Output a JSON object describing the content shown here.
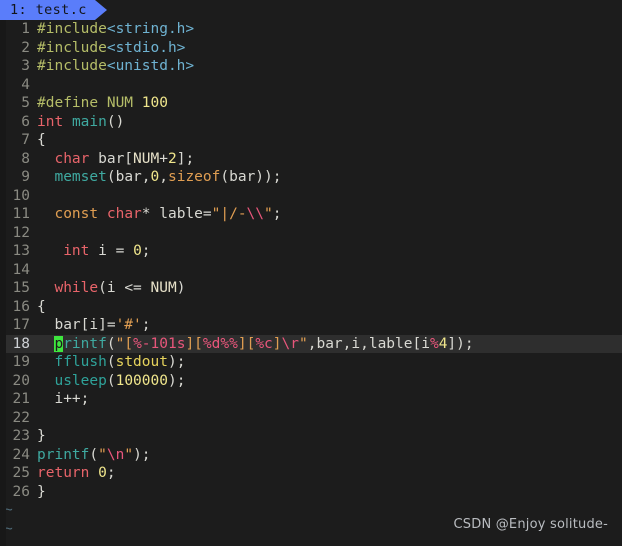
{
  "app": {
    "type": "terminal-text-editor",
    "background_color": "#1c1c1c",
    "default_text_color": "#d8d8d2"
  },
  "tabline": {
    "active_tab_label": "1: test.c",
    "tab_background_color": "#5a7dfa",
    "tab_text_color": "#13151b"
  },
  "gutter": {
    "line_number_color": "#8a8a82",
    "current_line_number_color": "#cfd2d6"
  },
  "cursor": {
    "line_number": 18,
    "column_char": "p",
    "block_color": "#3ee63e",
    "current_line_highlight_color": "#2e2e2e"
  },
  "code": {
    "language": "c",
    "filename": "test.c",
    "total_lines": 26,
    "lines": [
      {
        "n": "1",
        "text": "#include<string.h>"
      },
      {
        "n": "2",
        "text": "#include<stdio.h>"
      },
      {
        "n": "3",
        "text": "#include<unistd.h>"
      },
      {
        "n": "4",
        "text": ""
      },
      {
        "n": "5",
        "text": "#define NUM 100"
      },
      {
        "n": "6",
        "text": "int main()"
      },
      {
        "n": "7",
        "text": "{"
      },
      {
        "n": "8",
        "text": "  char bar[NUM+2];"
      },
      {
        "n": "9",
        "text": "  memset(bar,0,sizeof(bar));"
      },
      {
        "n": "10",
        "text": ""
      },
      {
        "n": "11",
        "text": "  const char* lable=\"|/-\\\\\";"
      },
      {
        "n": "12",
        "text": ""
      },
      {
        "n": "13",
        "text": "   int i = 0;"
      },
      {
        "n": "14",
        "text": ""
      },
      {
        "n": "15",
        "text": "  while(i <= NUM)"
      },
      {
        "n": "16",
        "text": "{"
      },
      {
        "n": "17",
        "text": "  bar[i]='#';"
      },
      {
        "n": "18",
        "text": "  printf(\"[%-101s][%d%%][%c]\\r\",bar,i,lable[i%4]);"
      },
      {
        "n": "19",
        "text": "  fflush(stdout);"
      },
      {
        "n": "20",
        "text": "  usleep(100000);"
      },
      {
        "n": "21",
        "text": "  i++;"
      },
      {
        "n": "22",
        "text": ""
      },
      {
        "n": "23",
        "text": "}"
      },
      {
        "n": "24",
        "text": "printf(\"\\n\");"
      },
      {
        "n": "25",
        "text": "return 0;"
      },
      {
        "n": "26",
        "text": "}"
      }
    ]
  },
  "empty_buffer_markers": {
    "symbol": "~",
    "count": 2,
    "color": "#4f6a78"
  },
  "watermark": {
    "text": "CSDN @Enjoy solitude-",
    "color": "#b9bcc0"
  },
  "syntax_colors": {
    "preprocessor": "#b5bd68",
    "include_path": "#6fb3d2",
    "type_keyword": "#e8646a",
    "control_keyword": "#e8646a",
    "function": "#3fa9a0",
    "number": "#f0e68c",
    "string": "#e09e52",
    "escape_format": "#e8567b",
    "macro": "#e6e0c8",
    "plain": "#d8d8d2"
  }
}
